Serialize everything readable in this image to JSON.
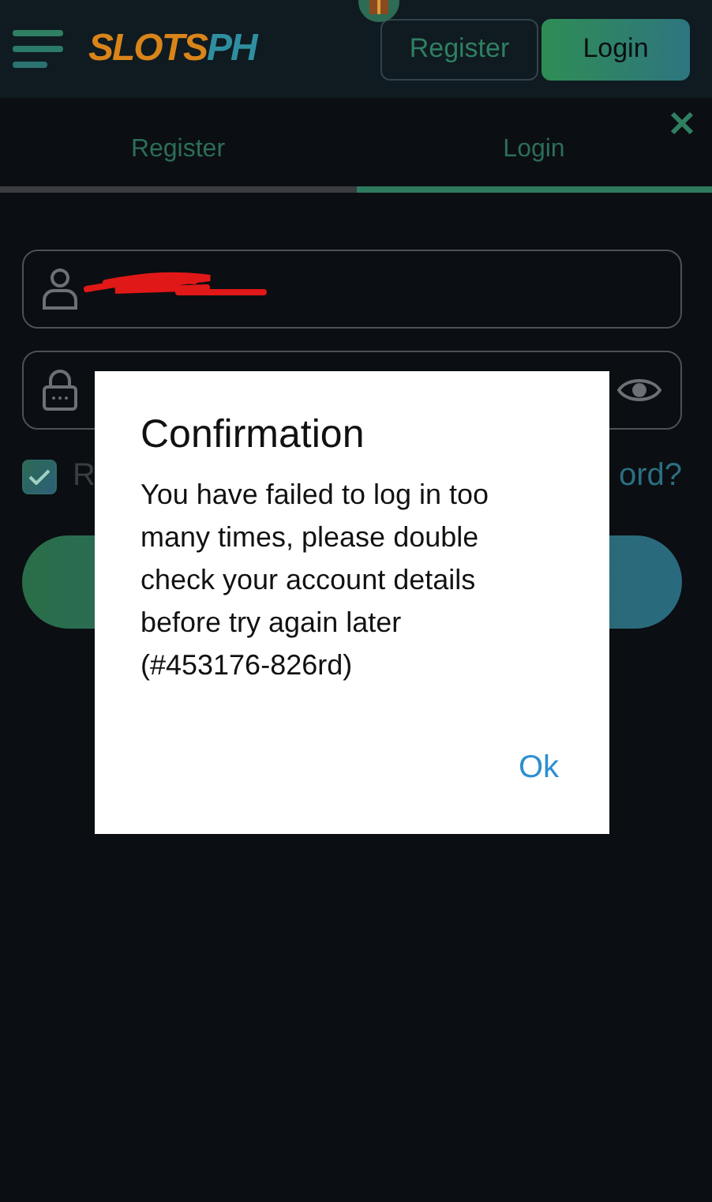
{
  "header": {
    "logo": [
      {
        "text": "SLOTS",
        "color": "#d9841a"
      },
      {
        "text": "PH",
        "color": "#2f8fa0"
      }
    ],
    "buttons": [
      {
        "label": "Register",
        "kind": "outline"
      },
      {
        "label": "Login",
        "kind": "filled"
      }
    ]
  },
  "tabs": [
    {
      "label": "Register",
      "selected": false
    },
    {
      "label": "Login",
      "selected": true
    }
  ],
  "remember": {
    "label": "R",
    "checked": true
  },
  "forgot_link": "ord?",
  "dialog": {
    "title": "Confirmation",
    "message": "You have failed to log in too many times, please double check your account details before try again later (#453176-826rd)",
    "button": "Ok"
  }
}
